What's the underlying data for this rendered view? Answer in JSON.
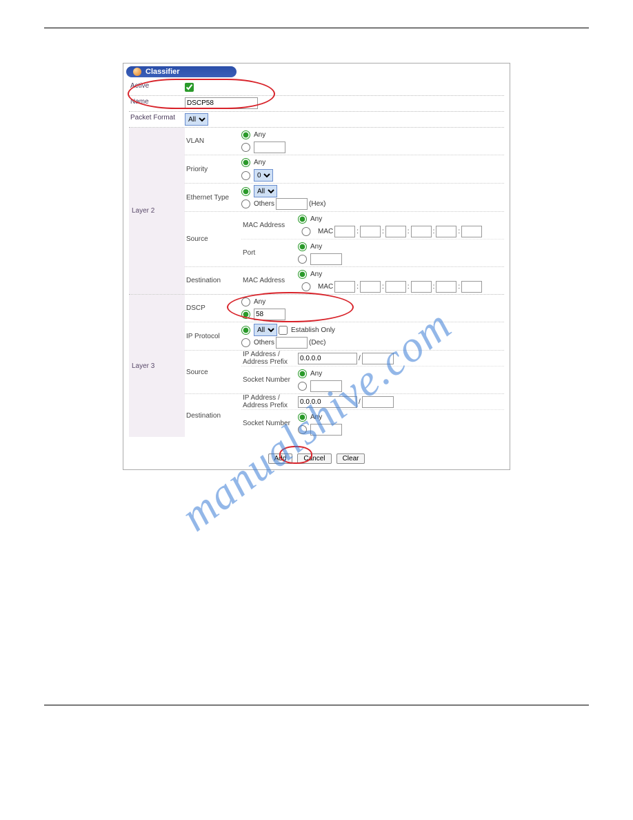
{
  "titlebar": "Classifier",
  "rows": {
    "active_label": "Active",
    "name_label": "Name",
    "name_value": "DSCP58",
    "packet_fmt_label": "Packet Format",
    "packet_fmt_value": "All"
  },
  "l2_label": "Layer 2",
  "l3_label": "Layer 3",
  "vlan_label": "VLAN",
  "priority_label": "Priority",
  "priority_value": "0",
  "eth_label": "Ethernet Type",
  "eth_all": "All",
  "others": "Others",
  "hex": "(Hex)",
  "dec": "(Dec)",
  "any": "Any",
  "source_label": "Source",
  "dest_label": "Destination",
  "mac_addr_label": "MAC Address",
  "mac_label": "MAC",
  "port_label": "Port",
  "dscp_label": "DSCP",
  "dscp_value": "58",
  "ipproto_label": "IP Protocol",
  "ipproto_all": "All",
  "establish_only": "Establish Only",
  "ipaddr_label": "IP Address /\nAddress Prefix",
  "ipaddr_value": "0.0.0.0",
  "socket_label": "Socket Number",
  "buttons": {
    "add": "Add",
    "cancel": "Cancel",
    "clear": "Clear"
  },
  "watermark": "manualshive.com"
}
